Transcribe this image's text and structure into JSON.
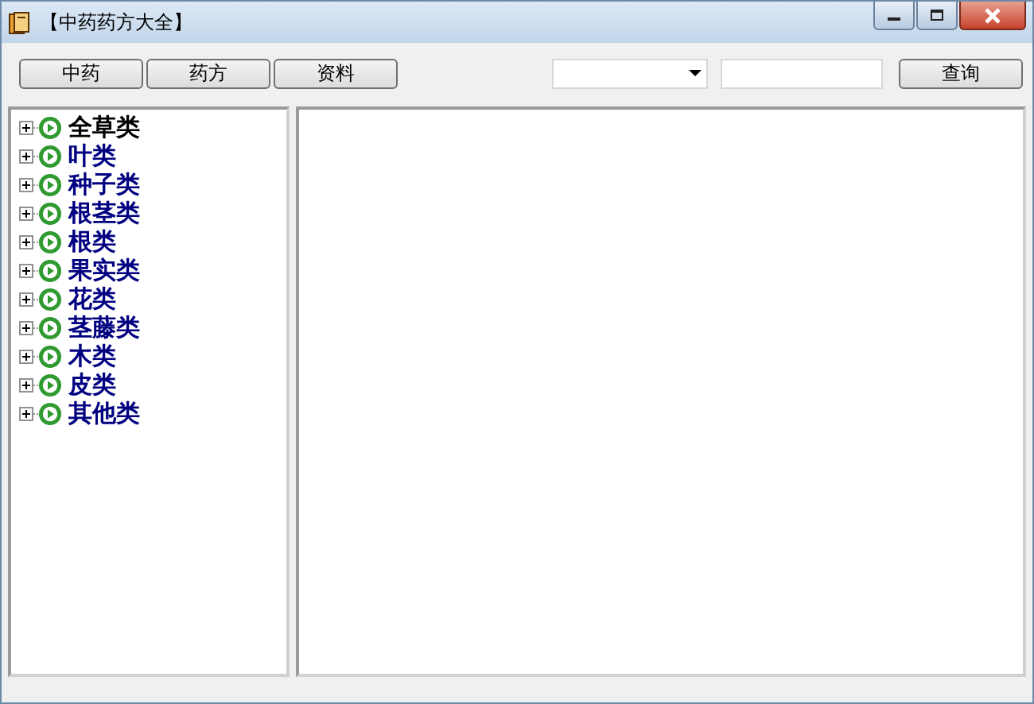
{
  "window": {
    "title": "【中药药方大全】"
  },
  "toolbar": {
    "buttons": [
      "中药",
      "药方",
      "资料"
    ],
    "search_button": "查询"
  },
  "tree": {
    "items": [
      {
        "label": "全草类",
        "color": "#000000",
        "expanded": false
      },
      {
        "label": "叶类",
        "color": "#000080",
        "expanded": false
      },
      {
        "label": "种子类",
        "color": "#000080",
        "expanded": false
      },
      {
        "label": "根茎类",
        "color": "#000080",
        "expanded": false
      },
      {
        "label": "根类",
        "color": "#000080",
        "expanded": false
      },
      {
        "label": "果实类",
        "color": "#000080",
        "expanded": false
      },
      {
        "label": "花类",
        "color": "#000080",
        "expanded": false
      },
      {
        "label": "茎藤类",
        "color": "#000080",
        "expanded": false
      },
      {
        "label": "木类",
        "color": "#000080",
        "expanded": false
      },
      {
        "label": "皮类",
        "color": "#000080",
        "expanded": false
      },
      {
        "label": "其他类",
        "color": "#000080",
        "expanded": false
      }
    ]
  }
}
